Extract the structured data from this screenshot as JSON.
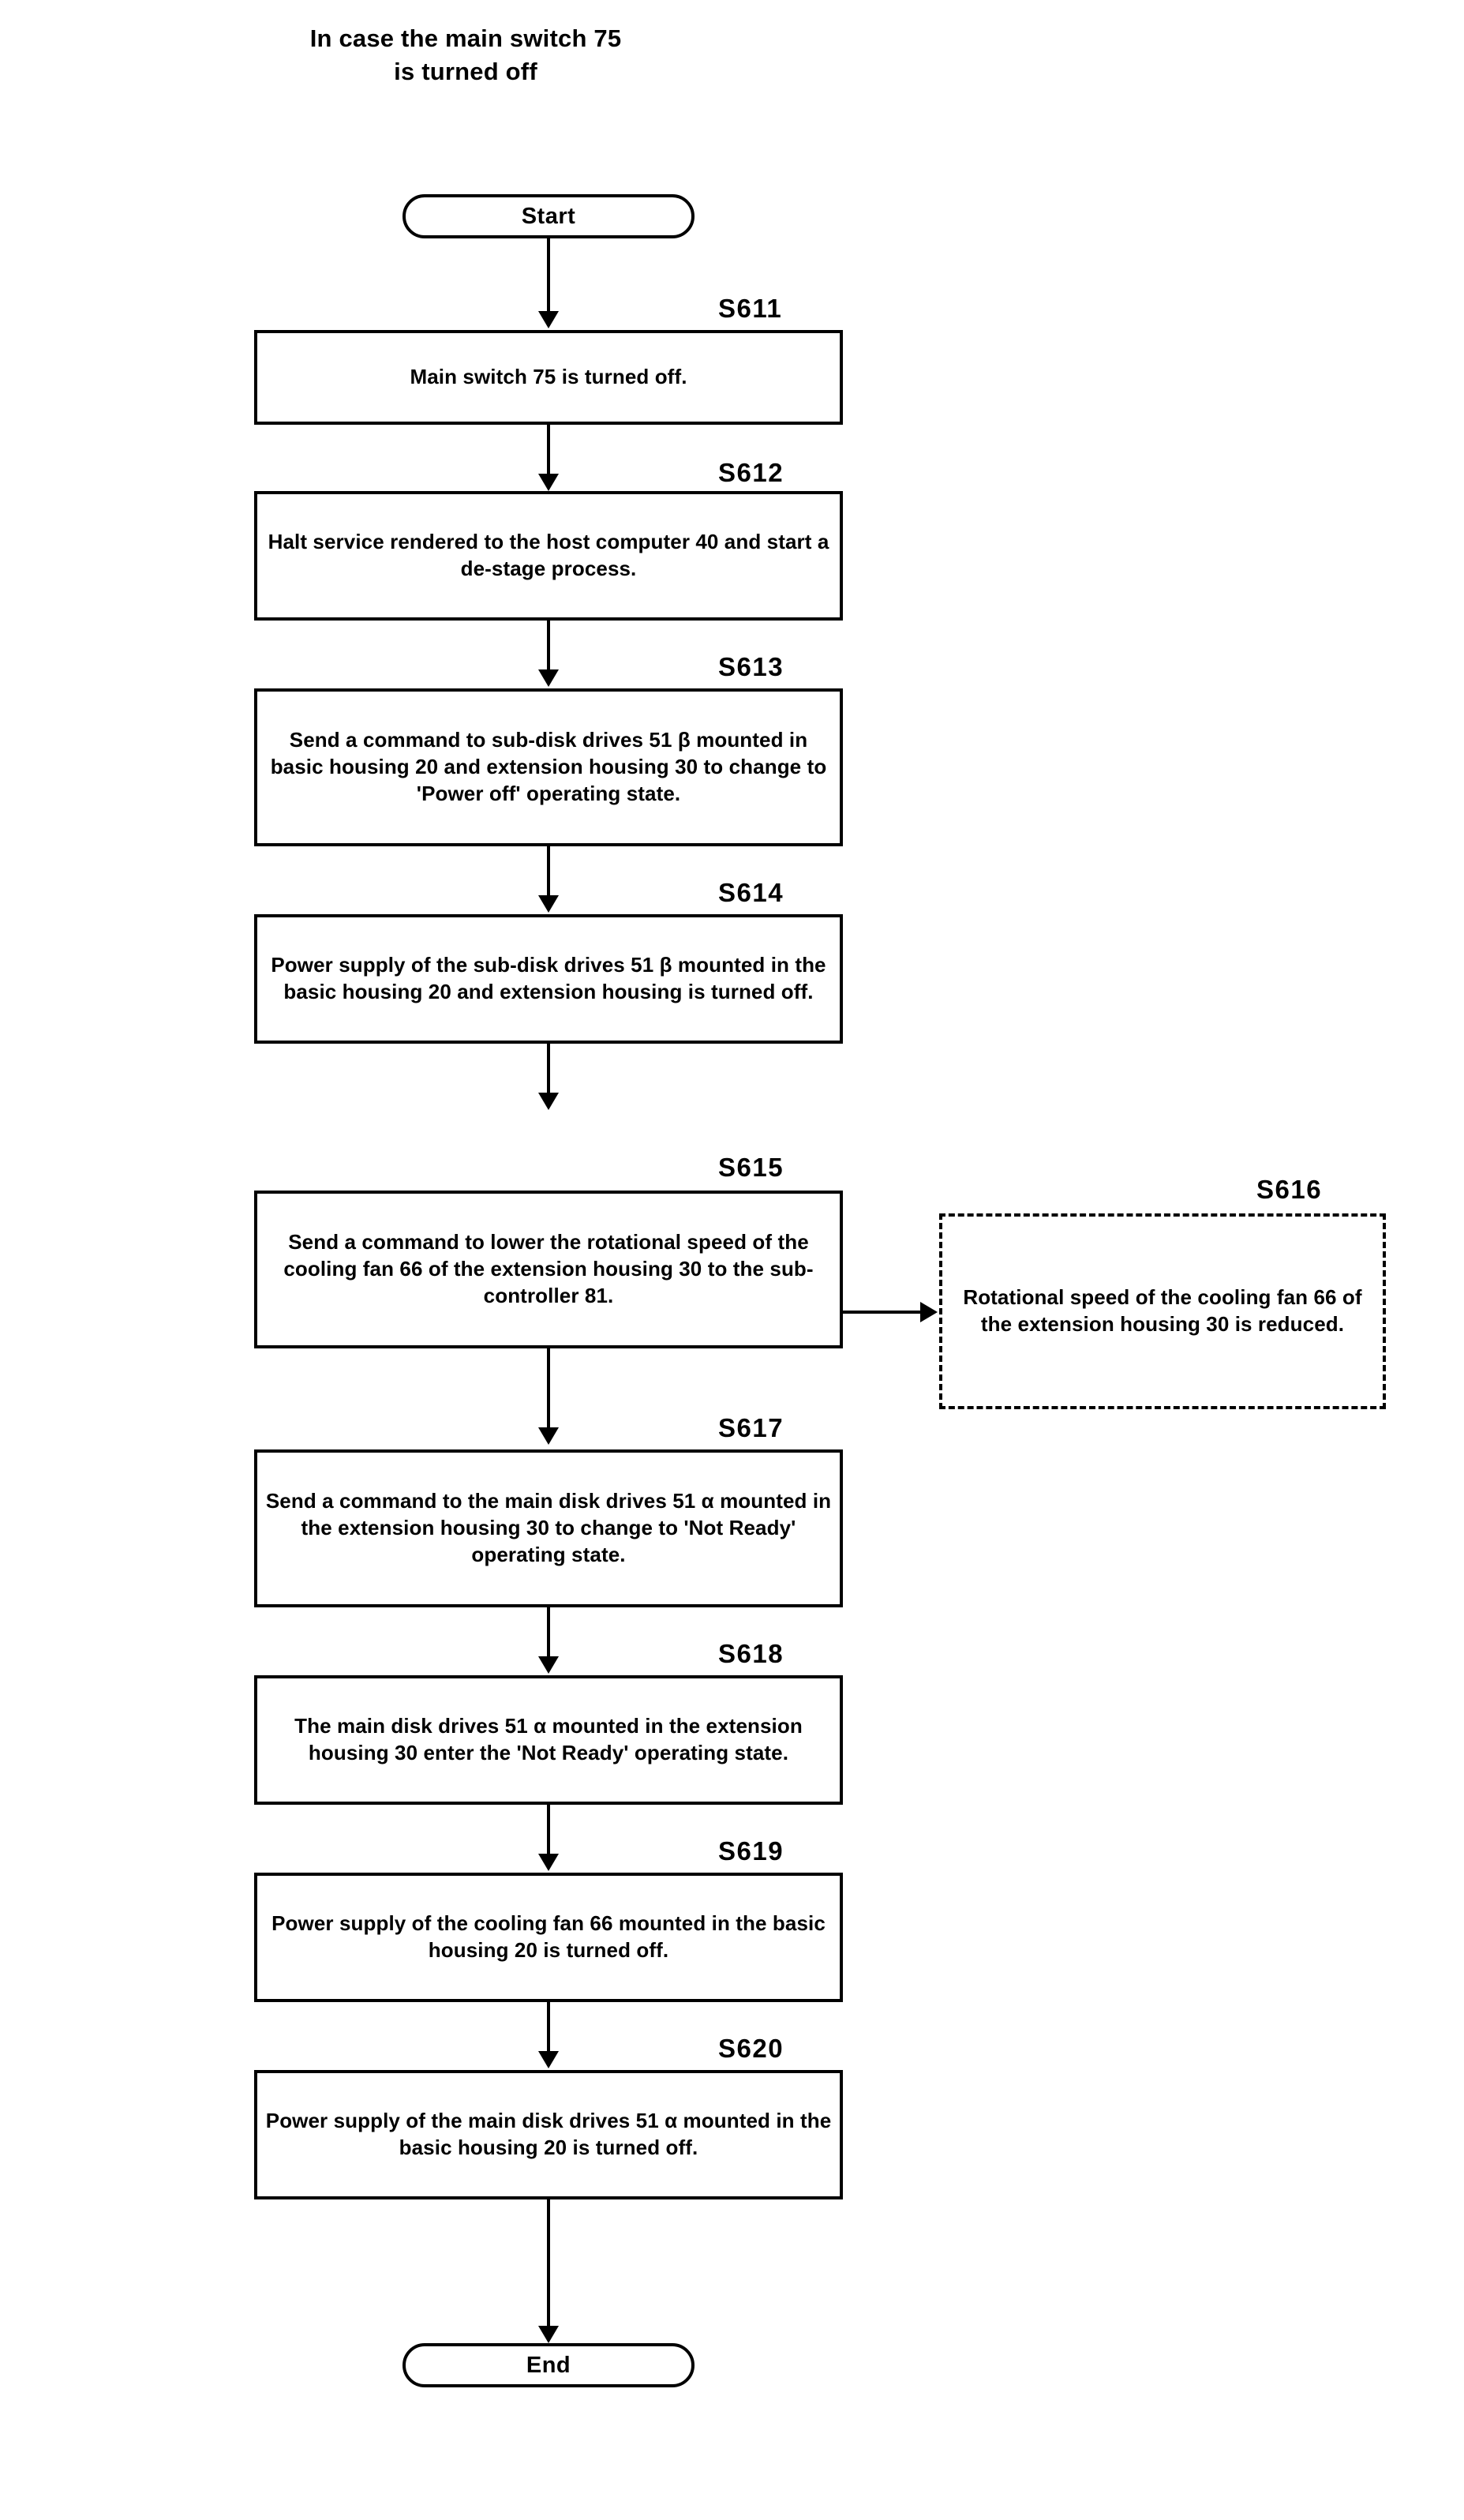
{
  "title": {
    "line1": "In case the main switch 75",
    "line2": "is turned off"
  },
  "terminators": {
    "start": "Start",
    "end": "End"
  },
  "steps": [
    {
      "id": "S611",
      "label": "S611",
      "text": "Main switch 75 is turned off.",
      "style": "solid"
    },
    {
      "id": "S612",
      "label": "S612",
      "text": "Halt service rendered to the host computer 40 and start a de-stage process.",
      "style": "solid"
    },
    {
      "id": "S613",
      "label": "S613",
      "text": "Send a command to sub-disk drives 51 β mounted in basic housing 20 and extension housing 30 to change to 'Power off' operating state.",
      "style": "solid"
    },
    {
      "id": "S614",
      "label": "S614",
      "text": "Power supply of the sub-disk drives 51 β mounted in the basic housing 20 and extension housing is turned off.",
      "style": "solid"
    },
    {
      "id": "S615",
      "label": "S615",
      "text": "Send a command to lower the rotational speed of the cooling fan 66 of the extension housing 30 to the sub-controller 81.",
      "style": "solid"
    },
    {
      "id": "S616",
      "label": "S616",
      "text": "Rotational speed of the cooling fan 66 of the extension housing 30 is reduced.",
      "style": "dashed"
    },
    {
      "id": "S617",
      "label": "S617",
      "text": "Send a command to the main disk drives 51 α mounted in the extension housing 30 to change to 'Not Ready' operating state.",
      "style": "solid"
    },
    {
      "id": "S618",
      "label": "S618",
      "text": "The main disk drives 51 α mounted in the extension housing 30 enter the 'Not Ready' operating state.",
      "style": "solid"
    },
    {
      "id": "S619",
      "label": "S619",
      "text": "Power supply of the cooling fan 66 mounted in the basic housing 20 is turned off.",
      "style": "solid"
    },
    {
      "id": "S620",
      "label": "S620",
      "text": "Power supply of the main disk drives 51 α mounted in the basic housing 20 is turned off.",
      "style": "solid"
    }
  ],
  "colors": {
    "stroke": "#000000",
    "background": "#ffffff"
  }
}
